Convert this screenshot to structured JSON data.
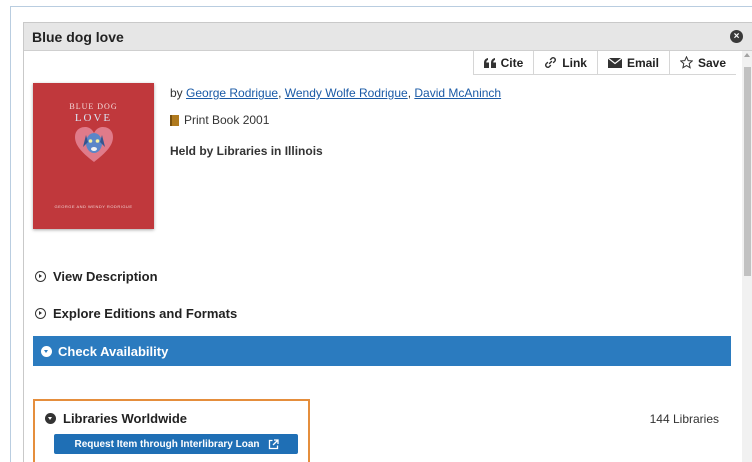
{
  "record": {
    "title": "Blue dog love",
    "close_label": "×"
  },
  "toolbar": {
    "cite": "Cite",
    "link": "Link",
    "email": "Email",
    "save": "Save"
  },
  "cover": {
    "line1": "BLUE DOG",
    "line2": "LOVE",
    "authors": "GEORGE AND WENDY RODRIGUE"
  },
  "byline": {
    "prefix": "by ",
    "authors": [
      "George Rodrigue",
      "Wendy Wolfe Rodrigue",
      "David McAninch"
    ],
    "sep": ", "
  },
  "format": {
    "text": "Print Book 2001"
  },
  "held": "Held by Libraries in Illinois",
  "sections": {
    "view_description": "View Description",
    "explore_editions": "Explore Editions and Formats",
    "check_availability": "Check Availability"
  },
  "worldwide": {
    "label": "Libraries Worldwide",
    "ill_button": "Request Item through Interlibrary Loan",
    "count": "144 Libraries"
  },
  "colors": {
    "accent_blue": "#2b7bbf",
    "highlight_orange": "#e58e3c",
    "link": "#1a5aa6"
  }
}
